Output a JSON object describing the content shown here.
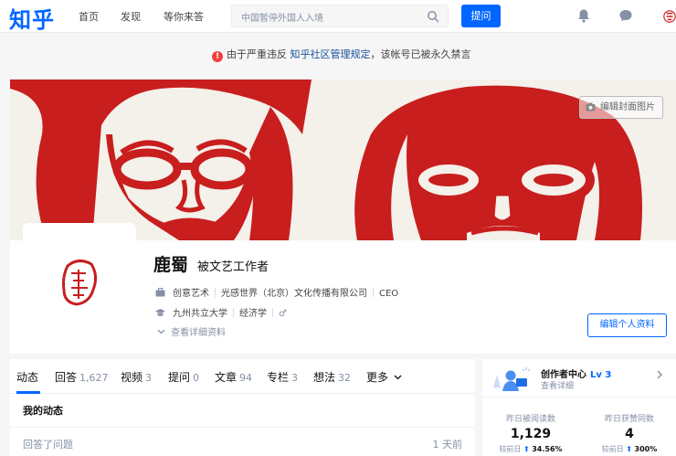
{
  "header": {
    "logo": "知乎",
    "nav": [
      "首页",
      "发现",
      "等你来答"
    ],
    "search_placeholder": "中国暂停外国人入境",
    "ask_label": "提问",
    "icons": [
      "bell-icon",
      "messages-icon",
      "user-menu-icon"
    ]
  },
  "banner": {
    "prefix": "由于严重违反",
    "link": "知乎社区管理规定",
    "suffix": "，该帐号已被永久禁言",
    "color": "#f1403c"
  },
  "cover": {
    "edit_label": "编辑封面图片",
    "paper_color": "#f4f0ea",
    "cut_color": "#c81e1e"
  },
  "profile": {
    "name": "鹿蜀",
    "headline": "被文艺工作者",
    "industry": "创意艺术",
    "company": "光感世界（北京）文化传播有限公司",
    "position": "CEO",
    "school": "九州共立大学",
    "major": "经济学",
    "gender_symbol": "♂",
    "detail_link": "查看详细资料",
    "edit_button": "编辑个人资料"
  },
  "tabs": [
    {
      "label": "动态",
      "count": ""
    },
    {
      "label": "回答",
      "count": "1,627"
    },
    {
      "label": "视频",
      "count": "3"
    },
    {
      "label": "提问",
      "count": "0"
    },
    {
      "label": "文章",
      "count": "94"
    },
    {
      "label": "专栏",
      "count": "3"
    },
    {
      "label": "想法",
      "count": "32"
    },
    {
      "label": "更多",
      "count": ""
    }
  ],
  "feed": {
    "section_title": "我的动态",
    "first_item_text": "回答了问题",
    "first_item_time": "1 天前"
  },
  "creator": {
    "title": "创作者中心",
    "level": "Lv 3",
    "subtitle": "查看详细",
    "stats": [
      {
        "label": "昨日被阅读数",
        "value": "1,129",
        "change_label": "较前日",
        "change": "34.56%"
      },
      {
        "label": "昨日获赞同数",
        "value": "4",
        "change_label": "较前日",
        "change": "300%"
      }
    ]
  },
  "colors": {
    "brand": "#0066ff",
    "link": "#175199",
    "muted": "#8590a6"
  }
}
